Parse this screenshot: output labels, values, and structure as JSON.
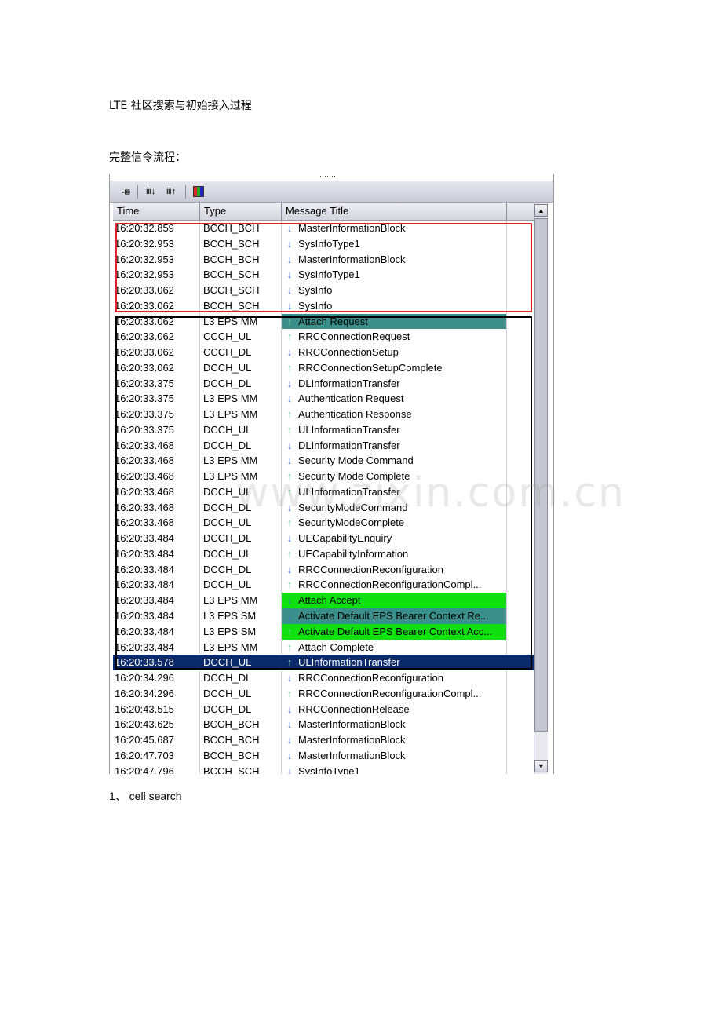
{
  "document": {
    "title": "LTE 社区搜索与初始接入过程",
    "subtitle": "完整信令流程：",
    "section_heading": "1、 cell search",
    "watermark": "www.zixin.com.cn"
  },
  "panel": {
    "toolbar": {
      "pin_icon": "-⊠",
      "find_down_icon": "ⅲ↓",
      "find_up_icon": "ⅲ↑",
      "color_icon": "color-grid-icon"
    },
    "columns": {
      "time": "Time",
      "type": "Type",
      "message": "Message Title"
    },
    "rows": [
      {
        "time": "16:20:32.859",
        "type": "BCCH_BCH",
        "message": "MasterInformationBlock",
        "dir": "down",
        "highlight": ""
      },
      {
        "time": "16:20:32.953",
        "type": "BCCH_SCH",
        "message": "SysInfoType1",
        "dir": "down",
        "highlight": ""
      },
      {
        "time": "16:20:32.953",
        "type": "BCCH_BCH",
        "message": "MasterInformationBlock",
        "dir": "down",
        "highlight": ""
      },
      {
        "time": "16:20:32.953",
        "type": "BCCH_SCH",
        "message": "SysInfoType1",
        "dir": "down",
        "highlight": ""
      },
      {
        "time": "16:20:33.062",
        "type": "BCCH_SCH",
        "message": "SysInfo",
        "dir": "down",
        "highlight": ""
      },
      {
        "time": "16:20:33.062",
        "type": "BCCH_SCH",
        "message": "SysInfo",
        "dir": "down",
        "highlight": ""
      },
      {
        "time": "16:20:33.062",
        "type": "L3 EPS MM",
        "message": "Attach Request",
        "dir": "up",
        "highlight": "teal"
      },
      {
        "time": "16:20:33.062",
        "type": "CCCH_UL",
        "message": "RRCConnectionRequest",
        "dir": "up",
        "highlight": ""
      },
      {
        "time": "16:20:33.062",
        "type": "CCCH_DL",
        "message": "RRCConnectionSetup",
        "dir": "down",
        "highlight": ""
      },
      {
        "time": "16:20:33.062",
        "type": "DCCH_UL",
        "message": "RRCConnectionSetupComplete",
        "dir": "up",
        "highlight": ""
      },
      {
        "time": "16:20:33.375",
        "type": "DCCH_DL",
        "message": "DLInformationTransfer",
        "dir": "down",
        "highlight": ""
      },
      {
        "time": "16:20:33.375",
        "type": "L3 EPS MM",
        "message": "Authentication Request",
        "dir": "down",
        "highlight": ""
      },
      {
        "time": "16:20:33.375",
        "type": "L3 EPS MM",
        "message": "Authentication Response",
        "dir": "up",
        "highlight": ""
      },
      {
        "time": "16:20:33.375",
        "type": "DCCH_UL",
        "message": "ULInformationTransfer",
        "dir": "up",
        "highlight": ""
      },
      {
        "time": "16:20:33.468",
        "type": "DCCH_DL",
        "message": "DLInformationTransfer",
        "dir": "down",
        "highlight": ""
      },
      {
        "time": "16:20:33.468",
        "type": "L3 EPS MM",
        "message": "Security Mode Command",
        "dir": "down",
        "highlight": ""
      },
      {
        "time": "16:20:33.468",
        "type": "L3 EPS MM",
        "message": "Security Mode Complete",
        "dir": "up",
        "highlight": ""
      },
      {
        "time": "16:20:33.468",
        "type": "DCCH_UL",
        "message": "ULInformationTransfer",
        "dir": "up",
        "highlight": ""
      },
      {
        "time": "16:20:33.468",
        "type": "DCCH_DL",
        "message": "SecurityModeCommand",
        "dir": "down",
        "highlight": ""
      },
      {
        "time": "16:20:33.468",
        "type": "DCCH_UL",
        "message": "SecurityModeComplete",
        "dir": "up",
        "highlight": ""
      },
      {
        "time": "16:20:33.484",
        "type": "DCCH_DL",
        "message": "UECapabilityEnquiry",
        "dir": "down",
        "highlight": ""
      },
      {
        "time": "16:20:33.484",
        "type": "DCCH_UL",
        "message": "UECapabilityInformation",
        "dir": "up",
        "highlight": ""
      },
      {
        "time": "16:20:33.484",
        "type": "DCCH_DL",
        "message": "RRCConnectionReconfiguration",
        "dir": "down",
        "highlight": ""
      },
      {
        "time": "16:20:33.484",
        "type": "DCCH_UL",
        "message": "RRCConnectionReconfigurationCompl...",
        "dir": "up",
        "highlight": ""
      },
      {
        "time": "16:20:33.484",
        "type": "L3 EPS MM",
        "message": "Attach Accept",
        "dir": "down",
        "highlight": "green"
      },
      {
        "time": "16:20:33.484",
        "type": "L3 EPS SM",
        "message": "Activate Default EPS Bearer Context Re...",
        "dir": "down",
        "highlight": "teal"
      },
      {
        "time": "16:20:33.484",
        "type": "L3 EPS SM",
        "message": "Activate Default EPS Bearer Context Acc...",
        "dir": "up",
        "highlight": "green"
      },
      {
        "time": "16:20:33.484",
        "type": "L3 EPS MM",
        "message": "Attach Complete",
        "dir": "up",
        "highlight": ""
      },
      {
        "time": "16:20:33.578",
        "type": "DCCH_UL",
        "message": "ULInformationTransfer",
        "dir": "up",
        "highlight": "selected"
      },
      {
        "time": "16:20:34.296",
        "type": "DCCH_DL",
        "message": "RRCConnectionReconfiguration",
        "dir": "down",
        "highlight": ""
      },
      {
        "time": "16:20:34.296",
        "type": "DCCH_UL",
        "message": "RRCConnectionReconfigurationCompl...",
        "dir": "up",
        "highlight": ""
      },
      {
        "time": "16:20:43.515",
        "type": "DCCH_DL",
        "message": "RRCConnectionRelease",
        "dir": "down",
        "highlight": ""
      },
      {
        "time": "16:20:43.625",
        "type": "BCCH_BCH",
        "message": "MasterInformationBlock",
        "dir": "down",
        "highlight": ""
      },
      {
        "time": "16:20:45.687",
        "type": "BCCH_BCH",
        "message": "MasterInformationBlock",
        "dir": "down",
        "highlight": ""
      },
      {
        "time": "16:20:47.703",
        "type": "BCCH_BCH",
        "message": "MasterInformationBlock",
        "dir": "down",
        "highlight": ""
      },
      {
        "time": "16:20:47.796",
        "type": "BCCH_SCH",
        "message": "SysInfoType1",
        "dir": "down",
        "highlight": ""
      }
    ],
    "colors": {
      "red_box": "#e0202a",
      "black_box": "#000000",
      "teal_highlight": "#3b8f8a",
      "green_highlight": "#10e010",
      "selected_row": "#0b2a6b",
      "arrow_down": "#3f6fd6",
      "arrow_up": "#6fd49a"
    }
  }
}
